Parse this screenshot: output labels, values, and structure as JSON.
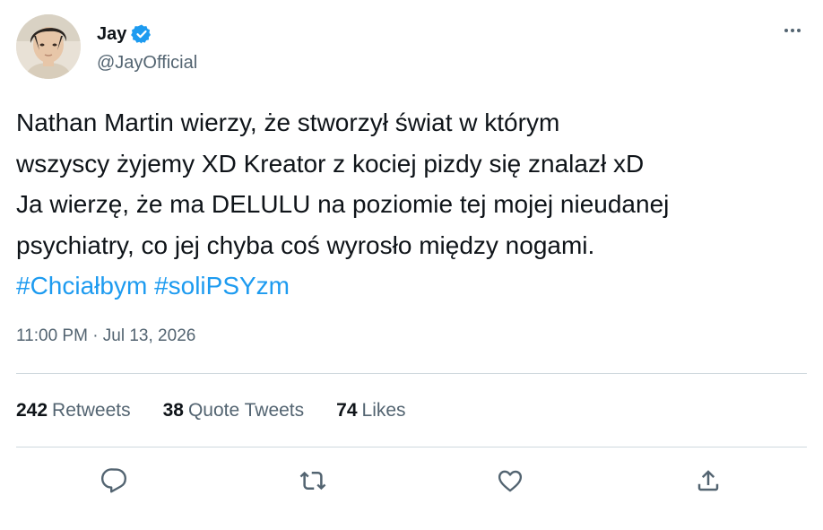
{
  "author": {
    "display_name": "Jay",
    "handle": "@JayOfficial",
    "verified": true,
    "avatar_icon": "profile-photo"
  },
  "tweet": {
    "text_lines": [
      "Nathan Martin wierzy, że stworzył świat w którym",
      "wszyscy żyjemy XD Kreator z kociej pizdy się znalazł xD",
      "Ja wierzę, że ma DELULU na poziomie tej mojej nieudanej",
      "psychiatry, co jej chyba coś wyrosło między nogami."
    ],
    "hashtags": [
      "#Chciałbym",
      "#soliPSYzm"
    ],
    "timestamp": "11:00 PM · Jul 13, 2026"
  },
  "stats": {
    "retweets": {
      "count": "242",
      "label": "Retweets"
    },
    "quote_tweets": {
      "count": "38",
      "label": "Quote Tweets"
    },
    "likes": {
      "count": "74",
      "label": "Likes"
    }
  },
  "actions": [
    "reply-icon",
    "retweet-icon",
    "like-icon",
    "share-icon"
  ],
  "colors": {
    "accent": "#1d9bf0",
    "text": "#0f1419",
    "secondary": "#536471",
    "divider": "#cfd9de"
  }
}
